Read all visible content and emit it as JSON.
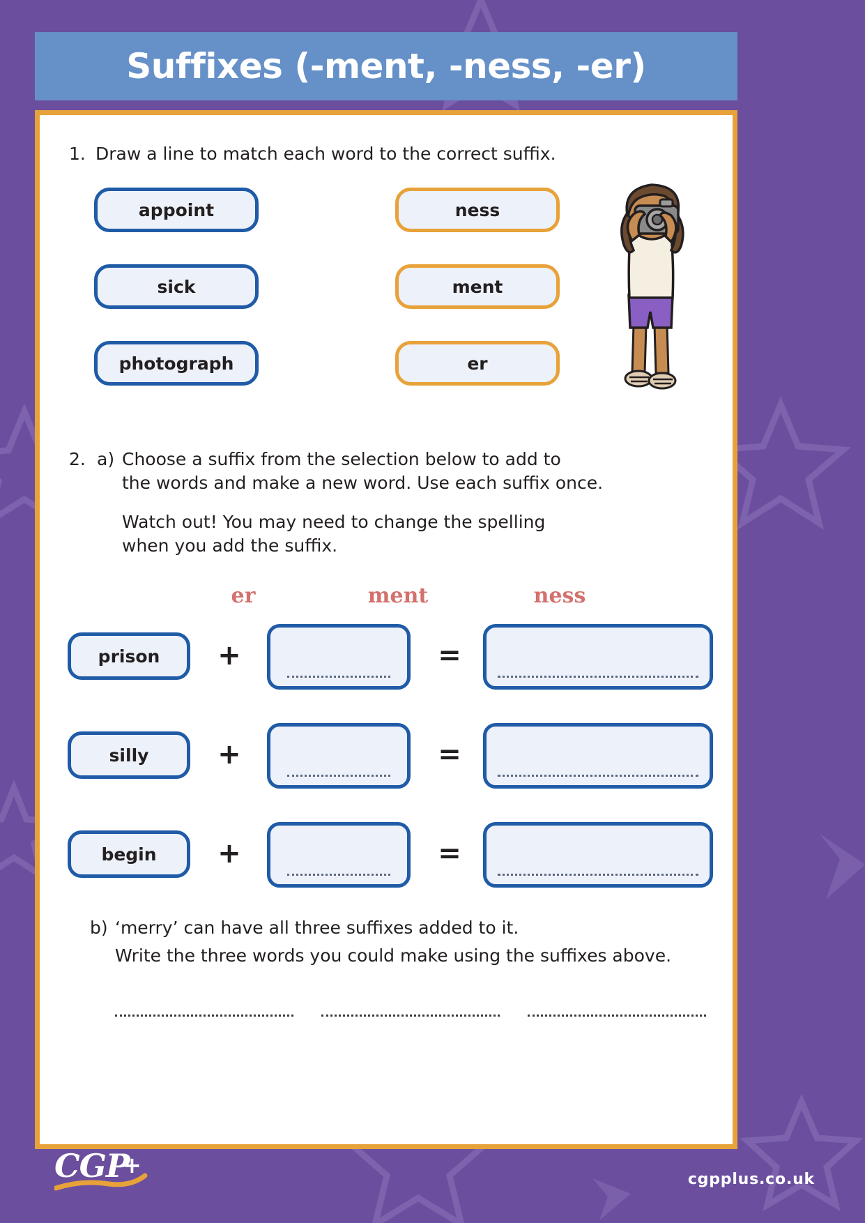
{
  "page": {
    "background_color": "#6b4f9e",
    "sheet_border_color": "#e8a23a",
    "banner_color": "#6590c8",
    "accent_blue": "#1f5ba6",
    "accent_orange": "#e8a23a",
    "suffix_red": "#d4706d"
  },
  "header": {
    "title": "Suffixes (-ment, -ness, -er)"
  },
  "q1": {
    "number": "1.",
    "instruction": "Draw a line to match each word to the correct suffix.",
    "words": [
      "appoint",
      "sick",
      "photograph"
    ],
    "suffixes": [
      "ness",
      "ment",
      "er"
    ]
  },
  "q2": {
    "number": "2.",
    "part_a_label": "a)",
    "part_a_line1": "Choose a suffix from the selection below to add to",
    "part_a_line2": "the words and make a new word. Use each suffix once.",
    "part_a_line3": "Watch out! You may need to change the spelling",
    "part_a_line4": "when you add the suffix.",
    "suffix_choices": [
      "er",
      "ment",
      "ness"
    ],
    "rows": [
      {
        "word": "prison",
        "plus": "+",
        "suffix_blank": "",
        "equals": "=",
        "answer_blank": ""
      },
      {
        "word": "silly",
        "plus": "+",
        "suffix_blank": "",
        "equals": "=",
        "answer_blank": ""
      },
      {
        "word": "begin",
        "plus": "+",
        "suffix_blank": "",
        "equals": "=",
        "answer_blank": ""
      }
    ],
    "part_b_label": "b)",
    "part_b_line1": "‘merry’ can have all three suffixes added to it.",
    "part_b_line2": "Write the three words you could make using the suffixes above.",
    "part_b_answer_lines": [
      "",
      "",
      ""
    ]
  },
  "illustration": {
    "name": "child-with-camera",
    "hair_color": "#6b4a2f",
    "skin_color": "#c68c52",
    "shirt_color": "#f5efe2",
    "shorts_color": "#8a5fc4",
    "camera_color": "#8a8a8a"
  },
  "footer": {
    "logo_text": "CGP",
    "logo_plus": "+",
    "url": "cgpplus.co.uk"
  }
}
